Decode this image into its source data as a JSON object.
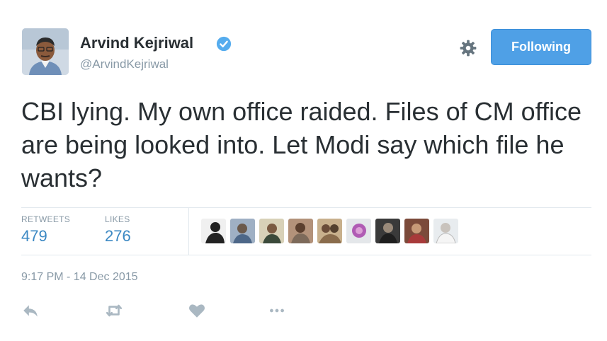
{
  "header": {
    "display_name": "Arvind Kejriwal",
    "handle": "@ArvindKejriwal",
    "verified_icon": "verified-badge-icon",
    "settings_icon": "gear-icon",
    "follow_label": "Following"
  },
  "tweet": {
    "text": "CBI lying. My own office raided. Files of CM office are being looked into. Let Modi say which file he wants?",
    "timestamp": "9:17 PM - 14 Dec 2015"
  },
  "stats": {
    "retweets_label": "RETWEETS",
    "retweets_count": "479",
    "likes_label": "LIKES",
    "likes_count": "276"
  },
  "likers": [
    {
      "icon": "liker-avatar"
    },
    {
      "icon": "liker-avatar"
    },
    {
      "icon": "liker-avatar"
    },
    {
      "icon": "liker-avatar"
    },
    {
      "icon": "liker-avatar"
    },
    {
      "icon": "liker-avatar"
    },
    {
      "icon": "liker-avatar"
    },
    {
      "icon": "liker-avatar"
    },
    {
      "icon": "liker-avatar"
    }
  ],
  "actions": [
    "reply-icon",
    "retweet-icon",
    "like-heart-icon",
    "more-options-icon"
  ],
  "colors": {
    "accent": "#4fa0e6",
    "link": "#3b88c3",
    "muted": "#8899a6",
    "text": "#292f33",
    "divider": "#e1e8ed"
  }
}
